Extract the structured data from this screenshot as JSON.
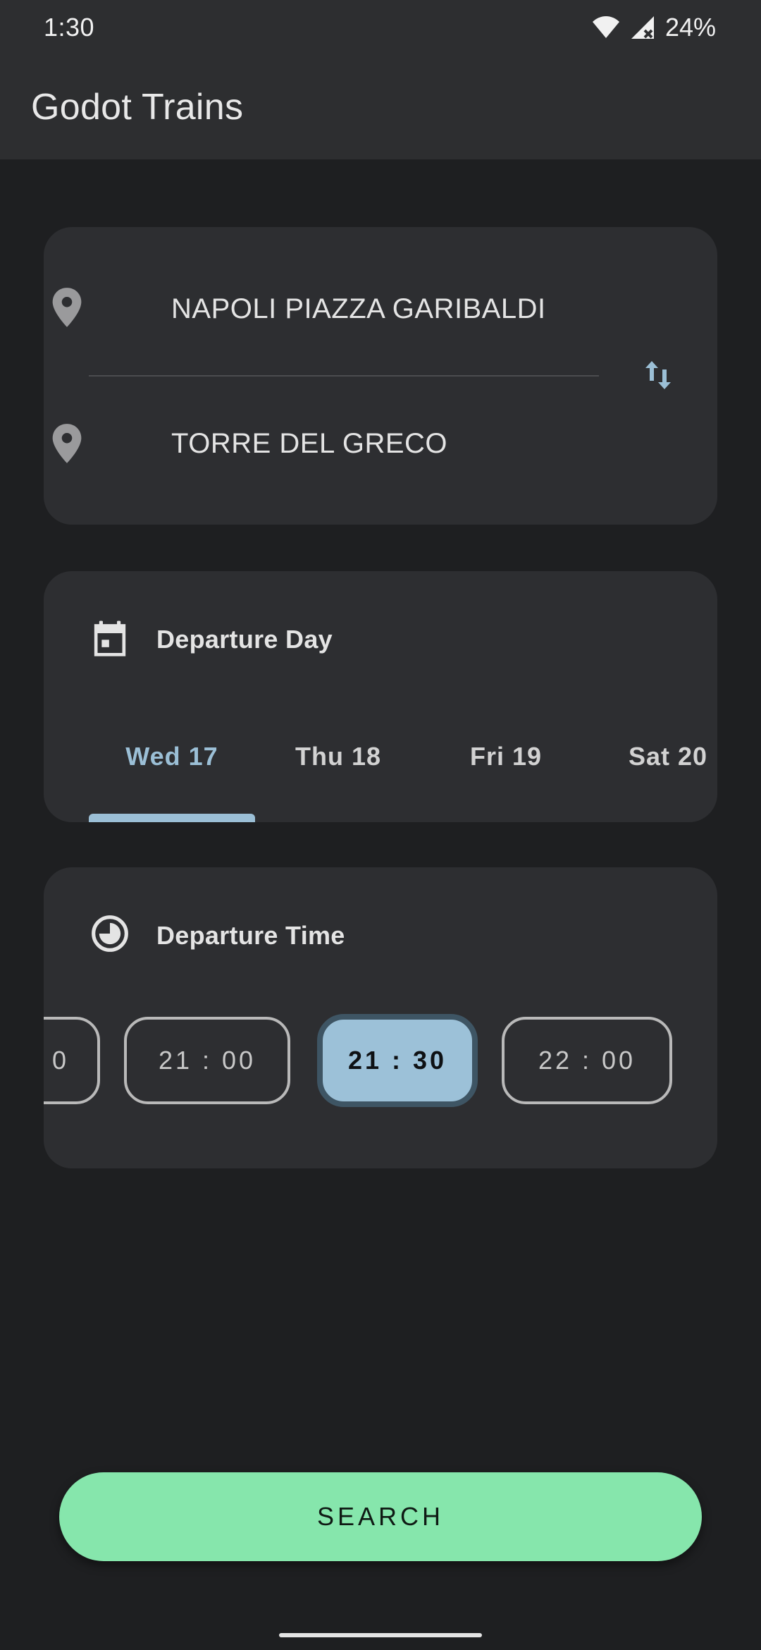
{
  "status_bar": {
    "time": "1:30",
    "battery": "24%",
    "icons": [
      "wifi-icon",
      "signal-off-icon"
    ]
  },
  "app_bar": {
    "title": "Godot Trains"
  },
  "route": {
    "from": "NAPOLI PIAZZA GARIBALDI",
    "to": "TORRE DEL GRECO",
    "icons": [
      "location-pin-icon",
      "swap-vertical-icon"
    ]
  },
  "departure_day": {
    "title": "Departure Day",
    "icon": "calendar-icon",
    "tabs": [
      {
        "label": "Wed 17",
        "selected": true
      },
      {
        "label": "Thu 18",
        "selected": false
      },
      {
        "label": "Fri 19",
        "selected": false
      },
      {
        "label": "Sat 20",
        "selected": false
      }
    ]
  },
  "departure_time": {
    "title": "Departure Time",
    "icon": "clock-icon",
    "chips": [
      {
        "label": "0",
        "selected": false
      },
      {
        "label": "21 : 00",
        "selected": false
      },
      {
        "label": "21 : 30",
        "selected": true
      },
      {
        "label": "22 : 00",
        "selected": false
      }
    ]
  },
  "search_button": {
    "label": "SEARCH"
  },
  "colors": {
    "background": "#1e1f21",
    "card": "#2d2e31",
    "accent_blue": "#9bbfd6",
    "search_green": "#86e6ac"
  }
}
